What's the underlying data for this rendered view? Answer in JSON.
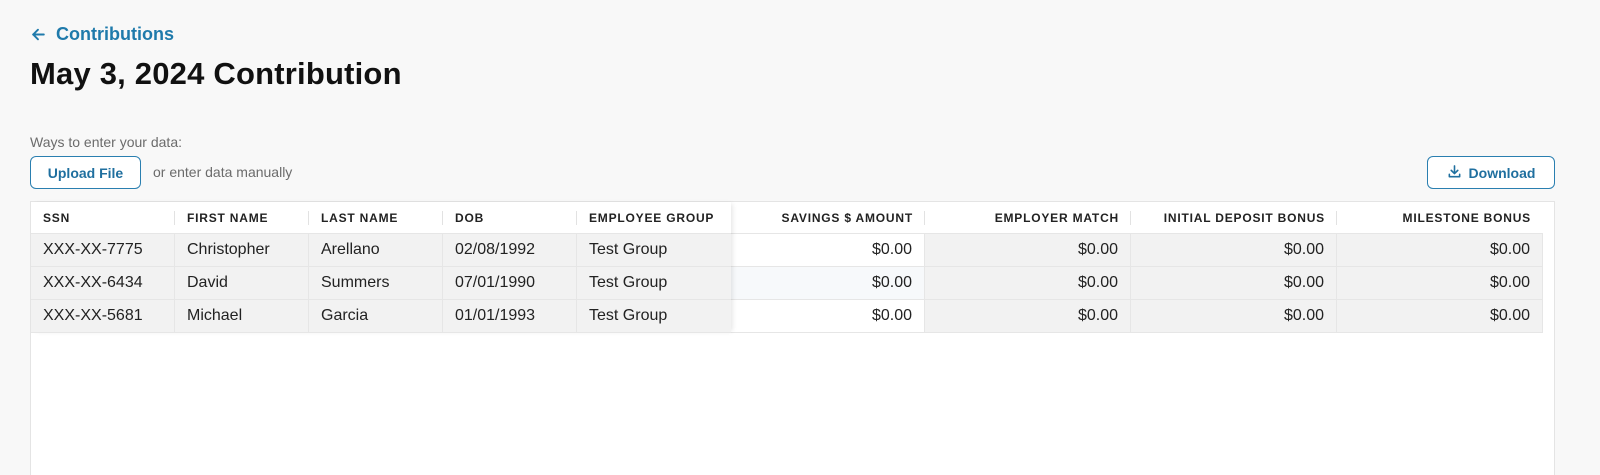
{
  "nav": {
    "back_label": "Contributions"
  },
  "page": {
    "title": "May 3, 2024 Contribution"
  },
  "entry": {
    "ways_label": "Ways to enter your data:",
    "upload_label": "Upload File",
    "manual_text": "or enter data manually",
    "download_label": "Download"
  },
  "table": {
    "headers": {
      "ssn": "SSN",
      "first_name": "FIRST NAME",
      "last_name": "LAST NAME",
      "dob": "DOB",
      "employee_group": "EMPLOYEE GROUP",
      "savings": "SAVINGS $ AMOUNT",
      "employer_match": "EMPLOYER MATCH",
      "initial_deposit_bonus": "INITIAL DEPOSIT BONUS",
      "milestone_bonus": "MILESTONE BONUS"
    },
    "rows": [
      {
        "ssn": "XXX-XX-7775",
        "first_name": "Christopher",
        "last_name": "Arellano",
        "dob": "02/08/1992",
        "employee_group": "Test Group",
        "savings": "$0.00",
        "employer_match": "$0.00",
        "initial_deposit_bonus": "$0.00",
        "milestone_bonus": "$0.00"
      },
      {
        "ssn": "XXX-XX-6434",
        "first_name": "David",
        "last_name": "Summers",
        "dob": "07/01/1990",
        "employee_group": "Test Group",
        "savings": "$0.00",
        "employer_match": "$0.00",
        "initial_deposit_bonus": "$0.00",
        "milestone_bonus": "$0.00"
      },
      {
        "ssn": "XXX-XX-5681",
        "first_name": "Michael",
        "last_name": "Garcia",
        "dob": "01/01/1993",
        "employee_group": "Test Group",
        "savings": "$0.00",
        "employer_match": "$0.00",
        "initial_deposit_bonus": "$0.00",
        "milestone_bonus": "$0.00"
      }
    ]
  },
  "colors": {
    "accent": "#1f7aab",
    "border": "#e4e4e4",
    "row_shade": "#f2f2f2"
  }
}
